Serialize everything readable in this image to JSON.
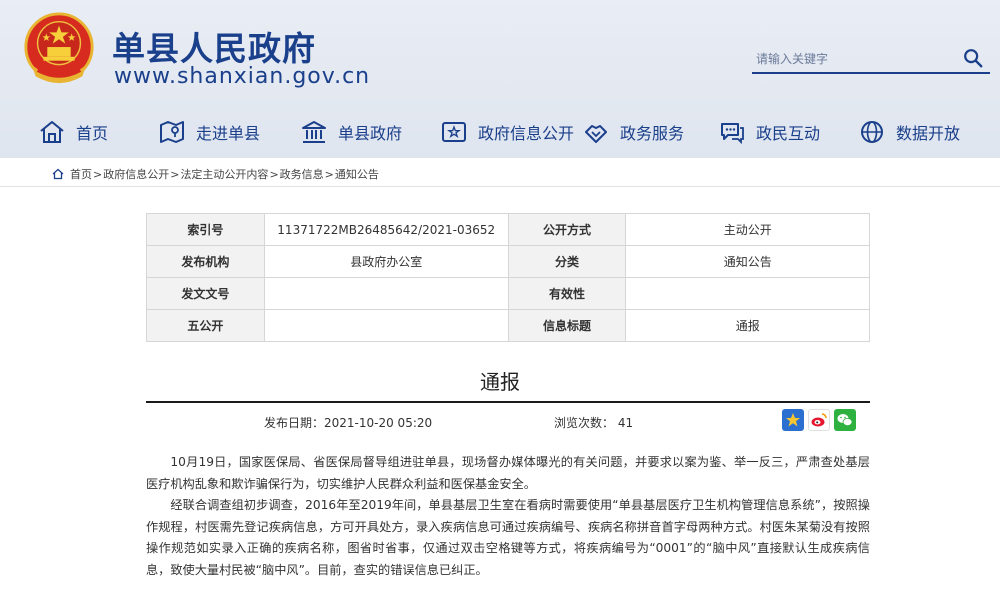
{
  "header": {
    "site_title": "单县人民政府",
    "site_domain": "www.shanxian.gov.cn",
    "search_placeholder": "请输入关键字"
  },
  "nav": [
    {
      "label": "首页",
      "icon": "home-icon"
    },
    {
      "label": "走进单县",
      "icon": "map-icon"
    },
    {
      "label": "单县政府",
      "icon": "government-building-icon"
    },
    {
      "label": "政府信息公开",
      "icon": "info-board-icon"
    },
    {
      "label": "政务服务",
      "icon": "handshake-icon"
    },
    {
      "label": "政民互动",
      "icon": "chat-bubbles-icon"
    },
    {
      "label": "数据开放",
      "icon": "data-globe-icon"
    }
  ],
  "breadcrumb": [
    "首页",
    "政府信息公开",
    "法定主动公开内容",
    "政务信息",
    "通知公告"
  ],
  "info_table": {
    "index_label": "索引号",
    "index_value": "11371722MB26485642/2021-03652",
    "method_label": "公开方式",
    "method_value": "主动公开",
    "publisher_label": "发布机构",
    "publisher_value": "县政府办公室",
    "category_label": "分类",
    "category_value": "通知公告",
    "docno_label": "发文文号",
    "docno_value": "",
    "validity_label": "有效性",
    "validity_value": "",
    "five_label": "五公开",
    "five_value": "",
    "infotitle_label": "信息标题",
    "infotitle_value": "通报"
  },
  "article": {
    "title": "通报",
    "date_text": "发布日期：2021-10-20 05:20",
    "views_text": "浏览次数： 41",
    "paragraphs": [
      "10月19日，国家医保局、省医保局督导组进驻单县，现场督办媒体曝光的有关问题，并要求以案为鉴、举一反三，严肃查处基层医疗机构乱象和欺诈骗保行为，切实维护人民群众利益和医保基金安全。",
      "经联合调查组初步调查，2016年至2019年间，单县基层卫生室在看病时需要使用“单县基层医疗卫生机构管理信息系统”，按照操作规程，村医需先登记疾病信息，方可开具处方，录入疾病信息可通过疾病编号、疾病名称拼音首字母两种方式。村医朱某菊没有按照操作规范如实录入正确的疾病名称，图省时省事，仅通过双击空格键等方式，将疾病编号为“0001”的“脑中风”直接默认生成疾病信息，致使大量村民被“脑中风”。目前，查实的错误信息已纠正。"
    ]
  },
  "colors": {
    "brand_blue": "#1a3f8b",
    "header_bg": "#e4e9f2",
    "table_label_bg": "#f2f2f2"
  }
}
